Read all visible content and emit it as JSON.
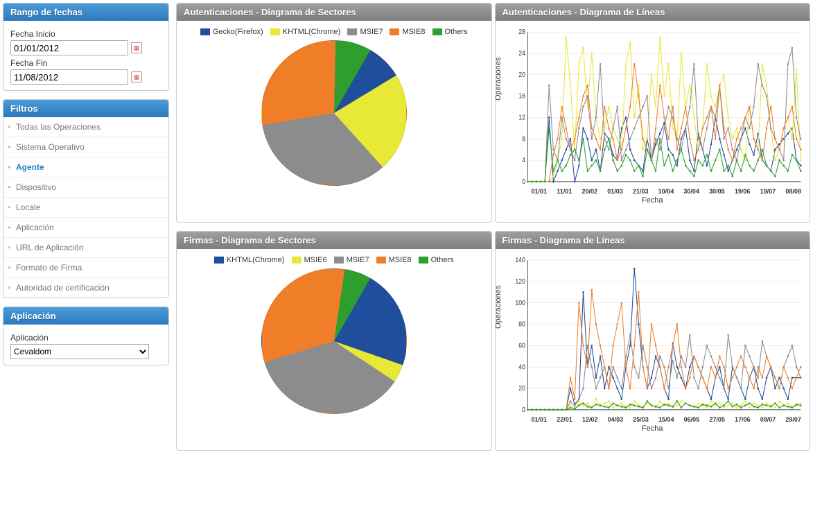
{
  "colors": {
    "blue": "#1f4e9c",
    "yellow": "#e8e836",
    "gray": "#8c8c8c",
    "orange": "#f07d28",
    "green": "#2f9e2f"
  },
  "sidebar": {
    "dateRange": {
      "title": "Rango de fechas",
      "startLabel": "Fecha Inicio",
      "startValue": "01/01/2012",
      "endLabel": "Fecha Fin",
      "endValue": "11/08/2012"
    },
    "filters": {
      "title": "Filtros",
      "items": [
        {
          "label": "Todas las Operaciones",
          "active": false
        },
        {
          "label": "Sistema Operativo",
          "active": false
        },
        {
          "label": "Agente",
          "active": true
        },
        {
          "label": "Dispositivo",
          "active": false
        },
        {
          "label": "Locale",
          "active": false
        },
        {
          "label": "Aplicación",
          "active": false
        },
        {
          "label": "URL de Aplicación",
          "active": false
        },
        {
          "label": "Formato de Firma",
          "active": false
        },
        {
          "label": "Autoridad de certificación",
          "active": false
        }
      ]
    },
    "application": {
      "title": "Aplicación",
      "label": "Aplicación",
      "selected": "Cevaldom"
    }
  },
  "charts": {
    "authPie": {
      "title": "Autenticaciones - Diagrama de Sectores"
    },
    "authLine": {
      "title": "Autenticaciones - Diagrama de Líneas",
      "ylabel": "Operaciones",
      "xlabel": "Fecha"
    },
    "sigPie": {
      "title": "Firmas - Diagrama de Sectores"
    },
    "sigLine": {
      "title": "Firmas - Diagrama de Líneas",
      "ylabel": "Operaciones",
      "xlabel": "Fecha"
    }
  },
  "chart_data": [
    {
      "id": "authPie",
      "type": "pie",
      "title": "Autenticaciones - Diagrama de Sectores",
      "series": [
        {
          "name": "Gecko(Firefox)",
          "value": 8,
          "color": "#1f4e9c"
        },
        {
          "name": "KHTML(Chrome)",
          "value": 22,
          "color": "#e8e836"
        },
        {
          "name": "MSIE7",
          "value": 34,
          "color": "#8c8c8c"
        },
        {
          "name": "MSIE8",
          "value": 28,
          "color": "#f07d28"
        },
        {
          "name": "Others",
          "value": 8,
          "color": "#2f9e2f"
        }
      ]
    },
    {
      "id": "authLine",
      "type": "line",
      "title": "Autenticaciones - Diagrama de Líneas",
      "xlabel": "Fecha",
      "ylabel": "Operaciones",
      "ylim": [
        0,
        28
      ],
      "yticks": [
        0,
        4,
        8,
        12,
        16,
        20,
        24,
        28
      ],
      "categories": [
        "01/01",
        "11/01",
        "20/02",
        "01/03",
        "21/03",
        "10/04",
        "30/04",
        "30/05",
        "19/06",
        "19/07",
        "08/08"
      ],
      "series": [
        {
          "name": "Gecko(Firefox)",
          "color": "#1f4e9c",
          "values": [
            0,
            0,
            0,
            0,
            0,
            12,
            0,
            2,
            4,
            6,
            8,
            0,
            3,
            10,
            8,
            4,
            6,
            2,
            9,
            8,
            5,
            4,
            10,
            12,
            6,
            4,
            3,
            2,
            8,
            4,
            7,
            9,
            11,
            6,
            5,
            3,
            8,
            10,
            4,
            2,
            9,
            6,
            3,
            7,
            12,
            8,
            5,
            2,
            4,
            6,
            8,
            10,
            7,
            5,
            9,
            4,
            3,
            2,
            6,
            7,
            8,
            9,
            10,
            4,
            3
          ]
        },
        {
          "name": "KHTML(Chrome)",
          "color": "#e8e836",
          "values": [
            0,
            0,
            0,
            0,
            0,
            0,
            1,
            4,
            8,
            27,
            18,
            6,
            22,
            25,
            14,
            24,
            12,
            8,
            10,
            14,
            10,
            8,
            6,
            22,
            26,
            12,
            18,
            6,
            8,
            20,
            14,
            27,
            16,
            22,
            10,
            8,
            24,
            14,
            18,
            12,
            6,
            10,
            22,
            16,
            14,
            18,
            20,
            12,
            8,
            10,
            6,
            4,
            14,
            8,
            6,
            22,
            18,
            10,
            4,
            6,
            10,
            12,
            8,
            21,
            4
          ]
        },
        {
          "name": "MSIE7",
          "color": "#8c8c8c",
          "values": [
            0,
            0,
            0,
            0,
            0,
            18,
            6,
            4,
            12,
            8,
            6,
            4,
            10,
            14,
            16,
            8,
            12,
            22,
            8,
            6,
            10,
            14,
            4,
            6,
            8,
            10,
            12,
            14,
            16,
            4,
            8,
            6,
            10,
            14,
            12,
            8,
            6,
            10,
            14,
            22,
            8,
            6,
            10,
            14,
            12,
            18,
            8,
            10,
            6,
            4,
            8,
            12,
            10,
            14,
            22,
            18,
            16,
            10,
            8,
            6,
            4,
            22,
            25,
            12,
            8
          ]
        },
        {
          "name": "MSIE8",
          "color": "#f07d28",
          "values": [
            0,
            0,
            0,
            0,
            0,
            0,
            5,
            8,
            14,
            10,
            6,
            8,
            12,
            16,
            18,
            10,
            8,
            6,
            14,
            10,
            8,
            4,
            6,
            10,
            14,
            22,
            16,
            8,
            6,
            4,
            10,
            18,
            12,
            8,
            14,
            6,
            10,
            14,
            8,
            4,
            6,
            10,
            12,
            14,
            8,
            18,
            10,
            6,
            4,
            8,
            10,
            12,
            14,
            8,
            6,
            4,
            10,
            14,
            8,
            6,
            10,
            12,
            14,
            8,
            6
          ]
        },
        {
          "name": "Others",
          "color": "#2f9e2f",
          "values": [
            0,
            0,
            0,
            0,
            0,
            10,
            2,
            4,
            2,
            3,
            5,
            6,
            4,
            8,
            2,
            3,
            4,
            2,
            6,
            8,
            4,
            2,
            3,
            5,
            4,
            2,
            3,
            1,
            6,
            4,
            2,
            8,
            3,
            5,
            2,
            4,
            6,
            3,
            2,
            1,
            4,
            3,
            5,
            2,
            4,
            6,
            2,
            3,
            1,
            4,
            2,
            5,
            3,
            2,
            4,
            6,
            3,
            2,
            1,
            4,
            3,
            2,
            5,
            4,
            2
          ]
        }
      ]
    },
    {
      "id": "sigPie",
      "type": "pie",
      "title": "Firmas - Diagrama de Sectores",
      "series": [
        {
          "name": "KHTML(Chrome)",
          "value": 22,
          "color": "#1f4e9c"
        },
        {
          "name": "MSIE6",
          "value": 4,
          "color": "#e8e836"
        },
        {
          "name": "MSIE7",
          "value": 36,
          "color": "#8c8c8c"
        },
        {
          "name": "MSIE8",
          "value": 32,
          "color": "#f07d28"
        },
        {
          "name": "Others",
          "value": 6,
          "color": "#2f9e2f"
        }
      ]
    },
    {
      "id": "sigLine",
      "type": "line",
      "title": "Firmas - Diagrama de Líneas",
      "xlabel": "Fecha",
      "ylabel": "Operaciones",
      "ylim": [
        0,
        140
      ],
      "yticks": [
        0,
        20,
        40,
        60,
        80,
        100,
        120,
        140
      ],
      "categories": [
        "01/01",
        "22/01",
        "12/02",
        "04/03",
        "25/03",
        "15/04",
        "06/05",
        "27/05",
        "17/06",
        "08/07",
        "29/07"
      ],
      "series": [
        {
          "name": "KHTML(Chrome)",
          "color": "#1f4e9c",
          "values": [
            0,
            0,
            0,
            0,
            0,
            0,
            0,
            0,
            0,
            0,
            20,
            5,
            10,
            110,
            40,
            60,
            30,
            50,
            20,
            40,
            30,
            20,
            10,
            40,
            60,
            132,
            80,
            40,
            20,
            30,
            50,
            40,
            20,
            10,
            62,
            40,
            30,
            20,
            40,
            50,
            40,
            30,
            20,
            10,
            30,
            40,
            20,
            10,
            40,
            30,
            20,
            10,
            30,
            40,
            20,
            10,
            30,
            40,
            20,
            30,
            20,
            10,
            30,
            30,
            30
          ]
        },
        {
          "name": "MSIE6",
          "color": "#e8e836",
          "values": [
            0,
            0,
            0,
            0,
            0,
            0,
            0,
            0,
            0,
            0,
            5,
            2,
            8,
            4,
            6,
            2,
            10,
            4,
            6,
            8,
            2,
            4,
            6,
            3,
            2,
            8,
            4,
            2,
            6,
            4,
            2,
            8,
            4,
            6,
            2,
            4,
            8,
            6,
            4,
            2,
            6,
            4,
            2,
            8,
            4,
            6,
            2,
            4,
            6,
            2,
            4,
            8,
            2,
            6,
            4,
            2,
            6,
            4,
            2,
            8,
            4,
            6,
            2,
            4,
            6
          ]
        },
        {
          "name": "MSIE7",
          "color": "#8c8c8c",
          "values": [
            0,
            0,
            0,
            0,
            0,
            0,
            0,
            0,
            0,
            0,
            8,
            4,
            10,
            20,
            60,
            40,
            20,
            30,
            40,
            20,
            40,
            30,
            20,
            50,
            70,
            40,
            30,
            60,
            40,
            20,
            30,
            50,
            40,
            20,
            46,
            30,
            50,
            40,
            70,
            30,
            20,
            40,
            60,
            50,
            40,
            30,
            20,
            70,
            40,
            30,
            20,
            60,
            50,
            40,
            30,
            64,
            50,
            40,
            30,
            20,
            40,
            50,
            60,
            40,
            30
          ]
        },
        {
          "name": "MSIE8",
          "color": "#f07d28",
          "values": [
            0,
            0,
            0,
            0,
            0,
            0,
            0,
            0,
            0,
            0,
            30,
            10,
            100,
            60,
            40,
            112,
            80,
            60,
            40,
            20,
            60,
            80,
            100,
            40,
            20,
            60,
            110,
            40,
            20,
            80,
            60,
            40,
            20,
            40,
            60,
            80,
            40,
            20,
            30,
            50,
            40,
            30,
            20,
            40,
            30,
            50,
            40,
            20,
            30,
            40,
            50,
            40,
            30,
            20,
            40,
            30,
            50,
            40,
            30,
            20,
            40,
            30,
            20,
            30,
            40
          ]
        },
        {
          "name": "Others",
          "color": "#2f9e2f",
          "values": [
            0,
            0,
            0,
            0,
            0,
            0,
            0,
            0,
            0,
            0,
            2,
            1,
            4,
            6,
            3,
            2,
            5,
            4,
            3,
            2,
            6,
            4,
            3,
            2,
            5,
            4,
            3,
            2,
            8,
            4,
            3,
            2,
            5,
            4,
            3,
            8,
            2,
            6,
            4,
            3,
            2,
            5,
            4,
            3,
            6,
            2,
            4,
            8,
            3,
            5,
            2,
            4,
            6,
            3,
            2,
            5,
            4,
            3,
            6,
            2,
            4,
            3,
            2,
            5,
            4
          ]
        }
      ]
    }
  ]
}
